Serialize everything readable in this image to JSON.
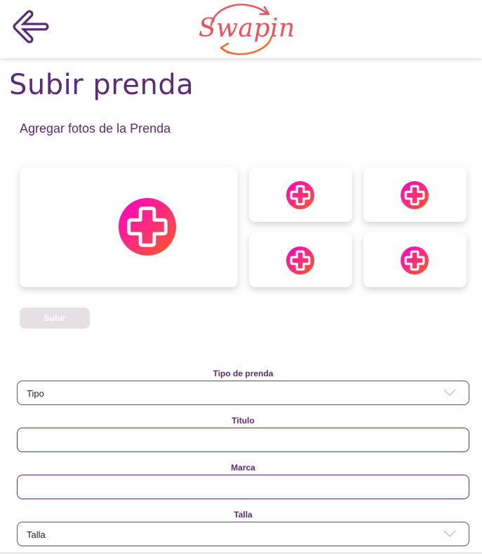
{
  "header": {
    "logo_text": "Swapin",
    "back_icon": "arrow-left-icon"
  },
  "page": {
    "title": "Subir prenda",
    "photos_label": "Agregar fotos de la Prenda",
    "upload_button": "Subir"
  },
  "photo_slots": {
    "count": 5,
    "icon": "add-photo-icon"
  },
  "form": {
    "tipo": {
      "label": "Tipo de prenda",
      "value": "Tipo"
    },
    "titulo": {
      "label": "Titulo",
      "value": ""
    },
    "marca": {
      "label": "Marca",
      "value": ""
    },
    "talla": {
      "label": "Talla",
      "value": "Talla"
    }
  },
  "colors": {
    "brand_purple": "#5b2a79",
    "gradient_start": "#ff00c8",
    "gradient_end": "#ff5a1f",
    "logo": "#f0505a",
    "disabled_button": "#e6dfe3"
  }
}
